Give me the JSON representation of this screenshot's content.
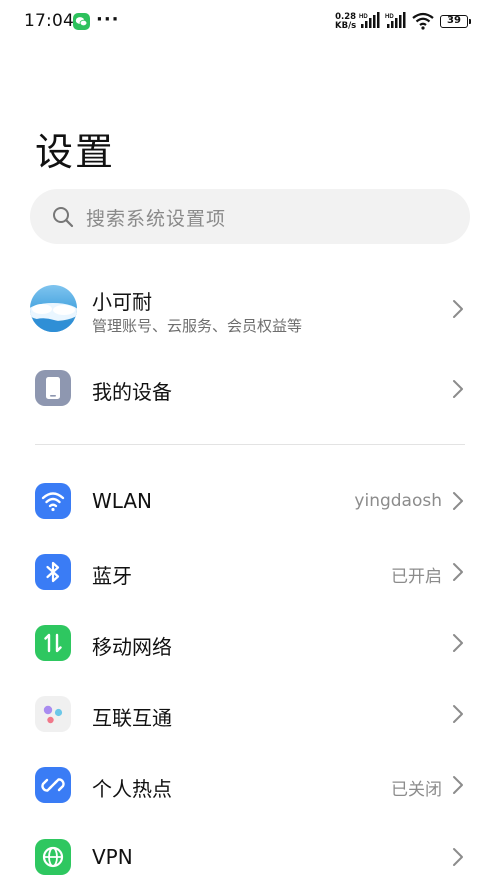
{
  "status_bar": {
    "time": "17:04",
    "more_indicator": "···",
    "net_speed_value": "0.28",
    "net_speed_unit": "KB/s",
    "signal1_label": "HD",
    "signal2_label": "HD",
    "battery": "39",
    "notification_icons": [
      "wechat-icon"
    ]
  },
  "page_title": "设置",
  "search": {
    "placeholder": "搜索系统设置项"
  },
  "account": {
    "name": "小可耐",
    "description": "管理账号、云服务、会员权益等"
  },
  "my_device": {
    "label": "我的设备"
  },
  "settings_items": [
    {
      "label": "WLAN",
      "value": "yingdaosh",
      "icon": "wifi-icon",
      "color": "#3a7cf5"
    },
    {
      "label": "蓝牙",
      "value": "已开启",
      "icon": "bluetooth-icon",
      "color": "#3a7cf5"
    },
    {
      "label": "移动网络",
      "value": "",
      "icon": "mobile-data-icon",
      "color": "#2ec760"
    },
    {
      "label": "互联互通",
      "value": "",
      "icon": "interconnect-icon",
      "color": "#f0f0f0"
    },
    {
      "label": "个人热点",
      "value": "已关闭",
      "icon": "hotspot-icon",
      "color": "#3a7cf5"
    },
    {
      "label": "VPN",
      "value": "",
      "icon": "vpn-icon",
      "color": "#2ec760"
    }
  ],
  "colors": {
    "accent_blue": "#3a7cf5",
    "accent_green": "#2ec760",
    "device_icon_gray": "#8e97b0",
    "search_background": "#f2f2f2"
  }
}
